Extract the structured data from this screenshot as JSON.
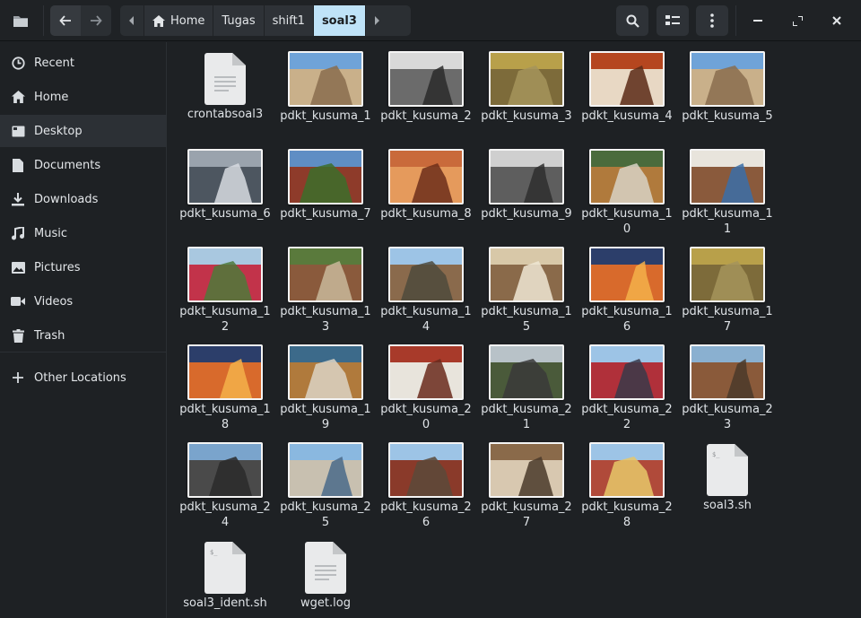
{
  "window": {
    "breadcrumbs": [
      {
        "label": "Home"
      },
      {
        "label": "Tugas"
      },
      {
        "label": "shift1"
      },
      {
        "label": "soal3"
      }
    ]
  },
  "icons": {
    "app": "file-manager-icon",
    "back": "arrow-left-icon",
    "forward": "arrow-right-icon",
    "search": "search-icon",
    "view": "list-view-icon",
    "menu": "kebab-menu-icon",
    "minimize": "minimize-icon",
    "maximize": "maximize-icon",
    "close": "close-icon"
  },
  "colors": {
    "accent": "#bfe3f8",
    "background": "#1e2124"
  },
  "sidebar": {
    "items": [
      {
        "label": "Recent",
        "icon": "clock-icon"
      },
      {
        "label": "Home",
        "icon": "home-icon"
      },
      {
        "label": "Desktop",
        "icon": "desktop-icon",
        "active": true
      },
      {
        "label": "Documents",
        "icon": "document-icon"
      },
      {
        "label": "Downloads",
        "icon": "download-icon"
      },
      {
        "label": "Music",
        "icon": "music-icon"
      },
      {
        "label": "Pictures",
        "icon": "picture-icon"
      },
      {
        "label": "Videos",
        "icon": "video-icon"
      },
      {
        "label": "Trash",
        "icon": "trash-icon"
      },
      {
        "label": "Other Locations",
        "icon": "plus-icon"
      }
    ]
  },
  "files": [
    {
      "name": "crontabsoal3",
      "kind": "text"
    },
    {
      "name": "pdkt_kusuma_1",
      "kind": "image",
      "palette": [
        "#6fa3d8",
        "#c9b08a",
        "#8a6d4e"
      ]
    },
    {
      "name": "pdkt_kusuma_2",
      "kind": "image",
      "palette": [
        "#d9d9d9",
        "#6b6b6b",
        "#2a2a2a"
      ]
    },
    {
      "name": "pdkt_kusuma_3",
      "kind": "image",
      "palette": [
        "#b8a04a",
        "#7d6b3a",
        "#a4945c"
      ]
    },
    {
      "name": "pdkt_kusuma_4",
      "kind": "image",
      "palette": [
        "#b5461f",
        "#e8d8c4",
        "#5a2a16"
      ]
    },
    {
      "name": "pdkt_kusuma_5",
      "kind": "image",
      "palette": [
        "#6fa3d8",
        "#c9b08a",
        "#8a6d4e"
      ]
    },
    {
      "name": "pdkt_kusuma_6",
      "kind": "image",
      "palette": [
        "#9aa3ad",
        "#4d5660",
        "#d7dbe0"
      ]
    },
    {
      "name": "pdkt_kusuma_7",
      "kind": "image",
      "palette": [
        "#5f8ec4",
        "#8e3b2a",
        "#3c6e2a"
      ]
    },
    {
      "name": "pdkt_kusuma_8",
      "kind": "image",
      "palette": [
        "#c96a3b",
        "#e59a5c",
        "#6d2e1a"
      ]
    },
    {
      "name": "pdkt_kusuma_9",
      "kind": "image",
      "palette": [
        "#cfcfcf",
        "#5e5e5e",
        "#2e2e2e"
      ]
    },
    {
      "name": "pdkt_kusuma_10",
      "kind": "image",
      "palette": [
        "#4a6b3c",
        "#b07a3c",
        "#d8d2c4"
      ]
    },
    {
      "name": "pdkt_kusuma_11",
      "kind": "image",
      "palette": [
        "#e8e4dc",
        "#8a5a3c",
        "#3a6ea8"
      ]
    },
    {
      "name": "pdkt_kusuma_12",
      "kind": "image",
      "palette": [
        "#a9c8e0",
        "#c2334a",
        "#4d7a3a"
      ]
    },
    {
      "name": "pdkt_kusuma_13",
      "kind": "image",
      "palette": [
        "#5a7a3c",
        "#8a5a3c",
        "#c8b89a"
      ]
    },
    {
      "name": "pdkt_kusuma_14",
      "kind": "image",
      "palette": [
        "#9dc4e6",
        "#8a6a4c",
        "#4d4a3c"
      ]
    },
    {
      "name": "pdkt_kusuma_15",
      "kind": "image",
      "palette": [
        "#d8c8a8",
        "#8a6a4a",
        "#efe6d4"
      ]
    },
    {
      "name": "pdkt_kusuma_16",
      "kind": "image",
      "palette": [
        "#2c3e6a",
        "#d86a2c",
        "#f4b04a"
      ]
    },
    {
      "name": "pdkt_kusuma_17",
      "kind": "image",
      "palette": [
        "#b8a04a",
        "#7d6b3a",
        "#a4945c"
      ]
    },
    {
      "name": "pdkt_kusuma_18",
      "kind": "image",
      "palette": [
        "#2c3e6a",
        "#d86a2c",
        "#f4b04a"
      ]
    },
    {
      "name": "pdkt_kusuma_19",
      "kind": "image",
      "palette": [
        "#3c6a8a",
        "#b07a3c",
        "#dcd4c4"
      ]
    },
    {
      "name": "pdkt_kusuma_20",
      "kind": "image",
      "palette": [
        "#a83a2a",
        "#e8e4dc",
        "#6a2a1c"
      ]
    },
    {
      "name": "pdkt_kusuma_21",
      "kind": "image",
      "palette": [
        "#b8c2c8",
        "#4a5a3a",
        "#3a3a3a"
      ]
    },
    {
      "name": "pdkt_kusuma_22",
      "kind": "image",
      "palette": [
        "#9dc4e6",
        "#b0303a",
        "#3a3a4a"
      ]
    },
    {
      "name": "pdkt_kusuma_23",
      "kind": "image",
      "palette": [
        "#8ab0d0",
        "#8a5a3a",
        "#4a3a2a"
      ]
    },
    {
      "name": "pdkt_kusuma_24",
      "kind": "image",
      "palette": [
        "#7aa4cc",
        "#4a4a4a",
        "#2a2a2a"
      ]
    },
    {
      "name": "pdkt_kusuma_25",
      "kind": "image",
      "palette": [
        "#8ab8e0",
        "#c8c0b0",
        "#4a6a8a"
      ]
    },
    {
      "name": "pdkt_kusuma_26",
      "kind": "image",
      "palette": [
        "#9dc4e6",
        "#8a3a2a",
        "#5a4a3a"
      ]
    },
    {
      "name": "pdkt_kusuma_27",
      "kind": "image",
      "palette": [
        "#8a6a4a",
        "#d8c8b0",
        "#4a3a2a"
      ]
    },
    {
      "name": "pdkt_kusuma_28",
      "kind": "image",
      "palette": [
        "#9dc4e6",
        "#b04a3a",
        "#e8c86a"
      ]
    },
    {
      "name": "soal3.sh",
      "kind": "script"
    },
    {
      "name": "soal3_ident.sh",
      "kind": "script"
    },
    {
      "name": "wget.log",
      "kind": "text"
    }
  ]
}
